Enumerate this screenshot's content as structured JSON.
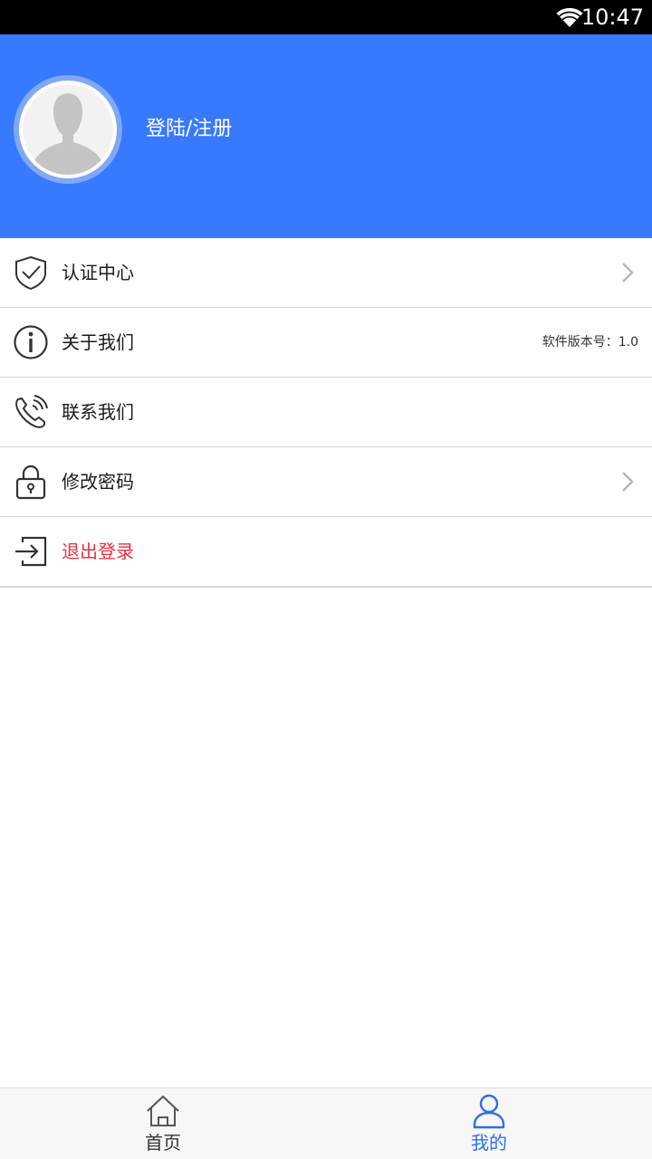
{
  "status_bar": {
    "time": "10:47",
    "wifi_icon": "wifi-icon"
  },
  "header": {
    "background_color": "#3779ff",
    "avatar_icon": "default-avatar-icon",
    "login_label": "登陆/注册"
  },
  "menu": {
    "items": [
      {
        "icon": "shield-check-icon",
        "label": "认证中心",
        "has_chevron": true
      },
      {
        "icon": "info-icon",
        "label": "关于我们",
        "meta": "软件版本号：1.0"
      },
      {
        "icon": "phone-icon",
        "label": "联系我们"
      },
      {
        "icon": "lock-icon",
        "label": "修改密码",
        "has_chevron": true
      },
      {
        "icon": "logout-icon",
        "label": "退出登录",
        "label_color": "#e8313f"
      }
    ]
  },
  "bottom_nav": {
    "tabs": [
      {
        "icon": "home-icon",
        "label": "首页",
        "active": false
      },
      {
        "icon": "user-icon",
        "label": "我的",
        "active": true,
        "active_color": "#2f6fe8"
      }
    ]
  }
}
